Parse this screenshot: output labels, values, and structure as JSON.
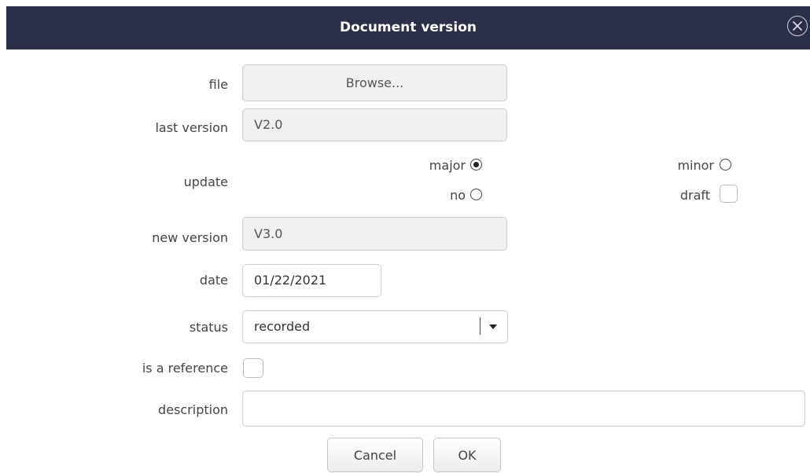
{
  "dialog": {
    "title": "Document version",
    "close_icon": "close-circle-icon"
  },
  "form": {
    "file": {
      "label": "file",
      "button_label": "Browse..."
    },
    "last_version": {
      "label": "last version",
      "value": "V2.0"
    },
    "update": {
      "label": "update",
      "options": {
        "major": {
          "label": "major",
          "checked": true
        },
        "minor": {
          "label": "minor",
          "checked": false
        },
        "no": {
          "label": "no",
          "checked": false
        },
        "draft": {
          "label": "draft",
          "checked": false
        }
      }
    },
    "new_version": {
      "label": "new version",
      "value": "V3.0"
    },
    "date": {
      "label": "date",
      "value": "01/22/2021"
    },
    "status": {
      "label": "status",
      "value": "recorded"
    },
    "is_reference": {
      "label": "is a reference",
      "checked": false
    },
    "description": {
      "label": "description",
      "value": ""
    }
  },
  "buttons": {
    "cancel": "Cancel",
    "ok": "OK"
  },
  "colors": {
    "titlebar": "#2c2f4a",
    "browse_text": "#e8843e",
    "readonly_bg": "#f0f0f0"
  }
}
